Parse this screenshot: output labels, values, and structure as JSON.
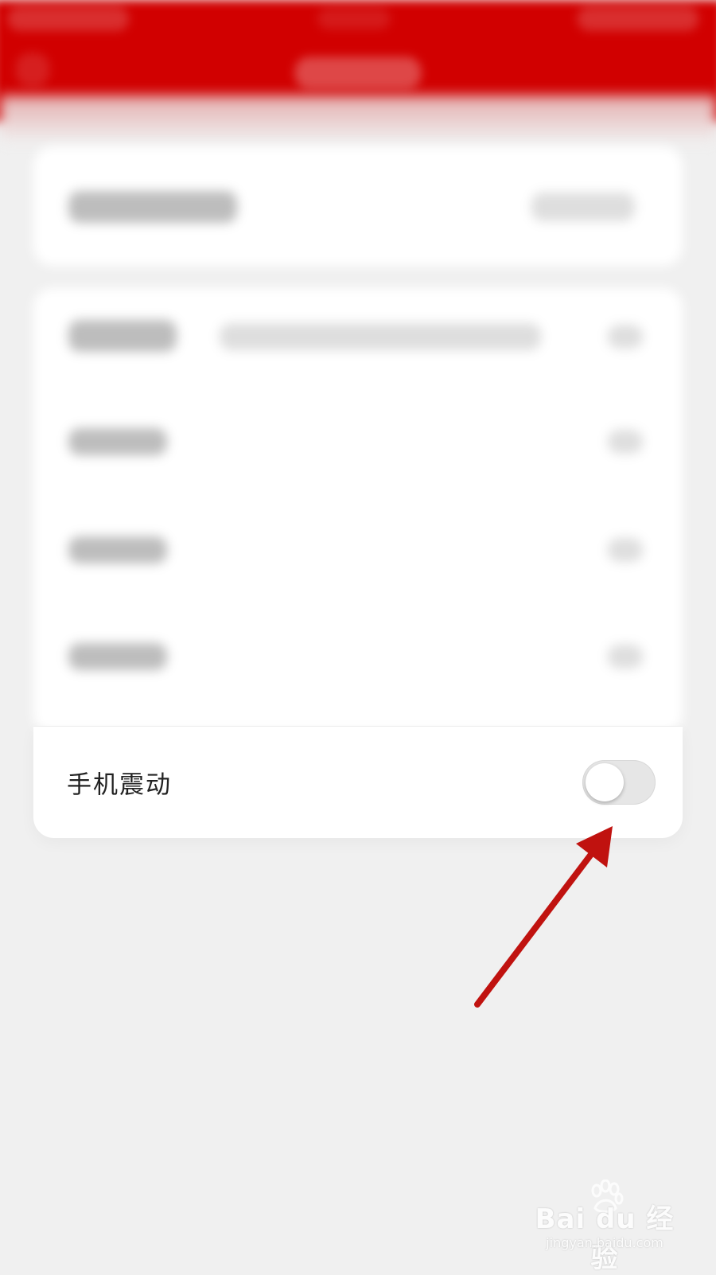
{
  "settings": {
    "vibrate_row": {
      "label": "手机震动",
      "toggle_on": false
    }
  },
  "watermark": {
    "brand": "Bai du 经验",
    "url": "jingyan.baidu.com"
  },
  "colors": {
    "header": "#d10000",
    "arrow": "#c0120f",
    "background": "#f0f0f0",
    "toggle_track": "#e6e6e6"
  },
  "icons": {
    "annotation": "arrow-annotation-icon",
    "watermark": "baidu-paw-icon"
  }
}
